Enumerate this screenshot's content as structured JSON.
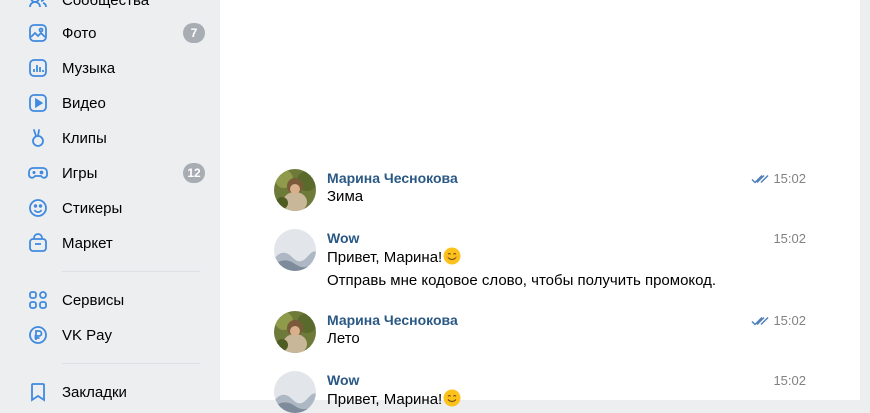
{
  "sidebar": {
    "items": [
      {
        "label": "Сообщества",
        "icon": "communities-icon"
      },
      {
        "label": "Фото",
        "icon": "photo-icon",
        "badge": "7"
      },
      {
        "label": "Музыка",
        "icon": "music-icon"
      },
      {
        "label": "Видео",
        "icon": "video-icon"
      },
      {
        "label": "Клипы",
        "icon": "clips-icon"
      },
      {
        "label": "Игры",
        "icon": "games-icon",
        "badge": "12"
      },
      {
        "label": "Стикеры",
        "icon": "stickers-icon"
      },
      {
        "label": "Маркет",
        "icon": "market-icon"
      },
      {
        "label": "Сервисы",
        "icon": "services-icon"
      },
      {
        "label": "VK Pay",
        "icon": "vkpay-icon"
      },
      {
        "label": "Закладки",
        "icon": "bookmarks-icon"
      }
    ]
  },
  "messages": [
    {
      "author": "Марина Чеснокова",
      "time": "15:02",
      "read": true,
      "avatar": "photo",
      "lines": [
        "Зима"
      ]
    },
    {
      "author": "Wow",
      "time": "15:02",
      "read": false,
      "avatar": "placeholder",
      "lines": [
        "Привет, Марина!",
        "Отправь мне кодовое слово, чтобы получить промокод."
      ]
    },
    {
      "author": "Марина Чеснокова",
      "time": "15:02",
      "read": true,
      "avatar": "photo",
      "lines": [
        "Лето"
      ]
    },
    {
      "author": "Wow",
      "time": "15:02",
      "read": false,
      "avatar": "placeholder",
      "lines": [
        "Привет, Марина!"
      ]
    }
  ],
  "colors": {
    "accent": "#2a5885",
    "badge": "#a8adb4",
    "icon": "#3f8ae0",
    "sidebar_bg": "#edeef0"
  }
}
